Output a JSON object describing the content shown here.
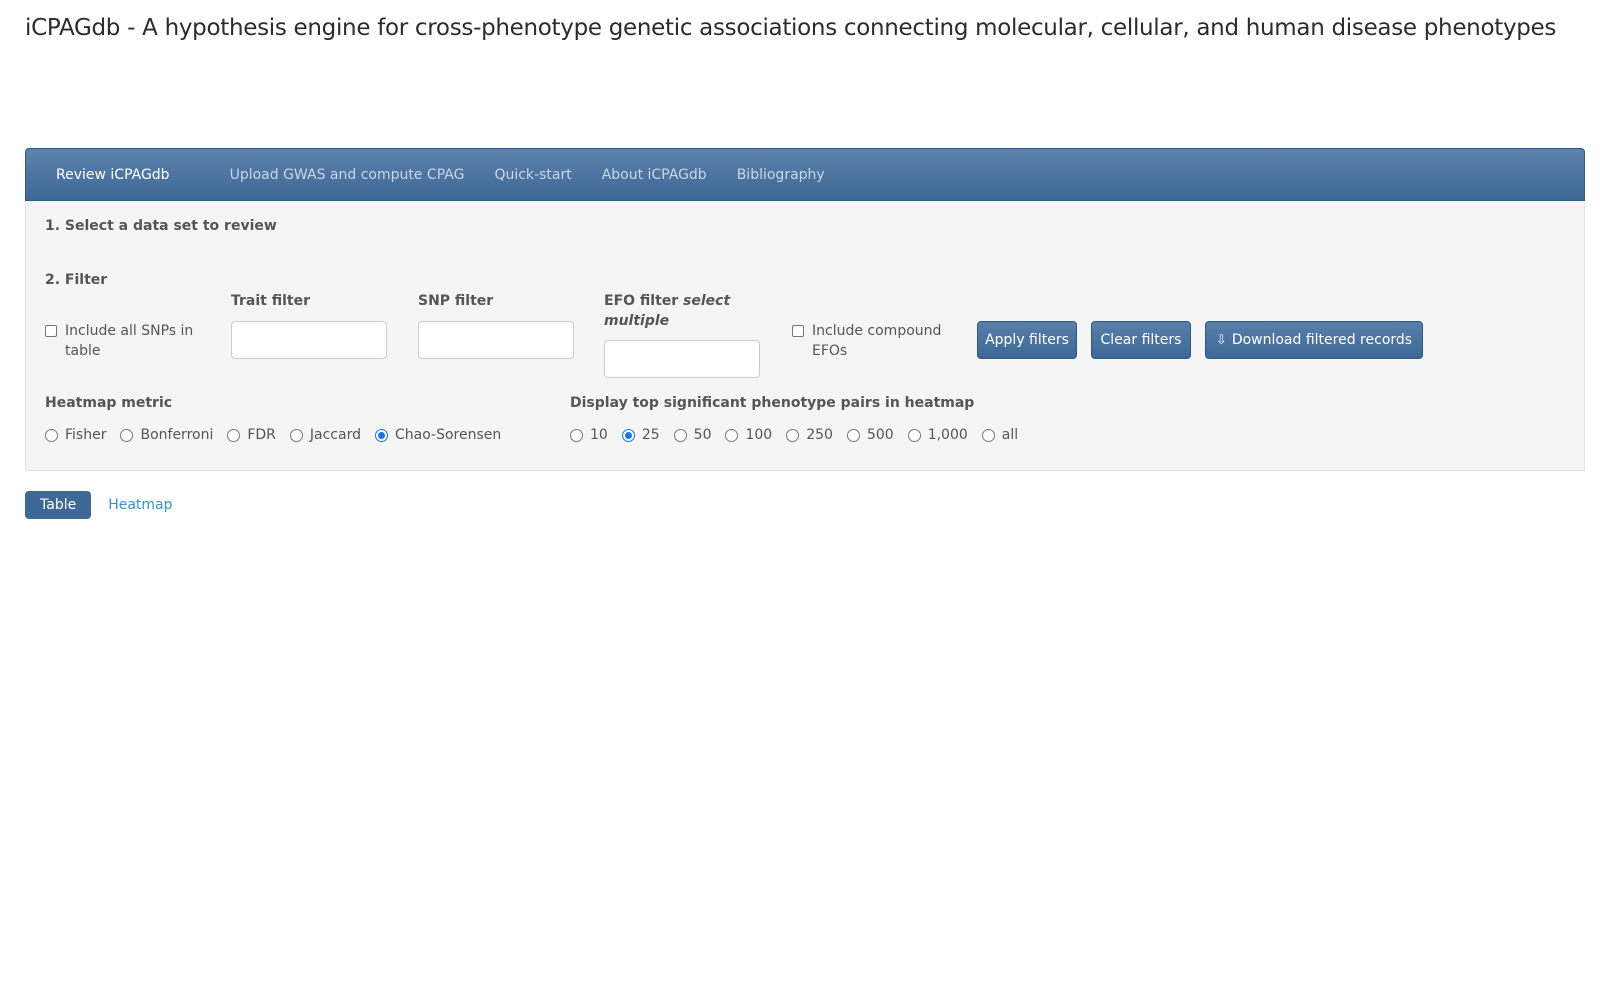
{
  "header": {
    "title": "iCPAGdb - A hypothesis engine for cross-phenotype genetic associations connecting molecular, cellular, and human disease phenotypes"
  },
  "nav": {
    "items": [
      {
        "label": "Review iCPAGdb",
        "active": true
      },
      {
        "label": "Upload GWAS and compute CPAG",
        "active": false
      },
      {
        "label": "Quick-start",
        "active": false
      },
      {
        "label": "About iCPAGdb",
        "active": false
      },
      {
        "label": "Bibliography",
        "active": false
      }
    ]
  },
  "panel": {
    "step1": "1. Select a data set to review",
    "step2": "2. Filter",
    "include_all_snps": "Include all SNPs in table",
    "trait_filter": {
      "label": "Trait filter",
      "value": ""
    },
    "snp_filter": {
      "label": "SNP filter",
      "value": ""
    },
    "efo_filter": {
      "label": "EFO filter",
      "label_hint": "select multiple",
      "value": ""
    },
    "include_compound_efos": "Include compound EFOs",
    "buttons": {
      "apply": "Apply filters",
      "clear": "Clear filters",
      "download": "Download filtered records"
    },
    "heatmap_metric": {
      "label": "Heatmap metric",
      "options": [
        "Fisher",
        "Bonferroni",
        "FDR",
        "Jaccard",
        "Chao-Sorensen"
      ],
      "selected": "Chao-Sorensen"
    },
    "top_pairs": {
      "label": "Display top significant phenotype pairs in heatmap",
      "options": [
        "10",
        "25",
        "50",
        "100",
        "250",
        "500",
        "1,000",
        "all"
      ],
      "selected": "25"
    }
  },
  "view_tabs": {
    "table": "Table",
    "heatmap": "Heatmap",
    "active": "Table"
  },
  "colors": {
    "navbar": "#4a729f",
    "accent": "#3e6896",
    "link": "#3a8fd6",
    "radio_checked": "#1a73e8"
  }
}
